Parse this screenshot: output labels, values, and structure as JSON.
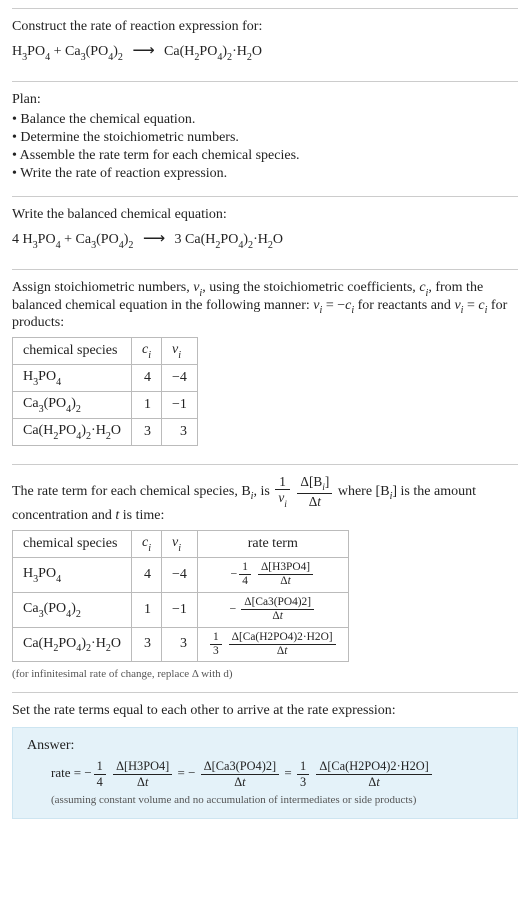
{
  "intro": {
    "prompt": "Construct the rate of reaction expression for:",
    "lhs1": "H",
    "lhs1s1": "3",
    "lhs1m": "PO",
    "lhs1s2": "4",
    "plus1": " + ",
    "lhs2": "Ca",
    "lhs2s1": "3",
    "lhs2m": "(PO",
    "lhs2s2": "4",
    "lhs2e": ")",
    "lhs2s3": "2",
    "arrow": "⟶",
    "rhs1": "Ca(H",
    "rhs1s1": "2",
    "rhs1m": "PO",
    "rhs1s2": "4",
    "rhs1e": ")",
    "rhs1s3": "2",
    "rhs1dot": "·H",
    "rhs1s4": "2",
    "rhs1o": "O"
  },
  "plan": {
    "label": "Plan:",
    "items": [
      "Balance the chemical equation.",
      "Determine the stoichiometric numbers.",
      "Assemble the rate term for each chemical species.",
      "Write the rate of reaction expression."
    ]
  },
  "balanced": {
    "label": "Write the balanced chemical equation:",
    "c1": "4 ",
    "c2": "",
    "c3": "3 "
  },
  "assign": {
    "text_a": "Assign stoichiometric numbers, ",
    "nu_i": "ν",
    "nu_i_sub": "i",
    "text_b": ", using the stoichiometric coefficients, ",
    "c_i": "c",
    "c_i_sub": "i",
    "text_c": ", from the balanced chemical equation in the following manner: ",
    "eq1a": "ν",
    "eq1as": "i",
    "eq1b": " = −",
    "eq1c": "c",
    "eq1cs": "i",
    "text_d": " for reactants and ",
    "eq2a": "ν",
    "eq2as": "i",
    "eq2b": " = ",
    "eq2c": "c",
    "eq2cs": "i",
    "text_e": " for products:"
  },
  "table1": {
    "h1": "chemical species",
    "h2": "c",
    "h2s": "i",
    "h3": "ν",
    "h3s": "i",
    "rows": [
      {
        "ci": "4",
        "vi": "−4"
      },
      {
        "ci": "1",
        "vi": "−1"
      },
      {
        "ci": "3",
        "vi": "3"
      }
    ]
  },
  "rateterm": {
    "text_a": "The rate term for each chemical species, B",
    "sub_i": "i",
    "text_b": ", is ",
    "frac1n": "1",
    "frac1d_a": "ν",
    "frac1d_s": "i",
    "frac2n": "Δ[B",
    "frac2n_s": "i",
    "frac2n_e": "]",
    "frac2d": "Δt",
    "text_c": " where [B",
    "text_c_s": "i",
    "text_c_e": "] is the amount concentration and ",
    "t_var": "t",
    "text_d": " is time:"
  },
  "table2": {
    "h1": "chemical species",
    "h2": "c",
    "h2s": "i",
    "h3": "ν",
    "h3s": "i",
    "h4": "rate term",
    "rows": [
      {
        "ci": "4",
        "vi": "−4",
        "sign": "−",
        "fn": "1",
        "fd": "4",
        "conc": "Δ[H3PO4]"
      },
      {
        "ci": "1",
        "vi": "−1",
        "sign": "−",
        "fn": "",
        "fd": "",
        "conc": "Δ[Ca3(PO4)2]"
      },
      {
        "ci": "3",
        "vi": "3",
        "sign": "",
        "fn": "1",
        "fd": "3",
        "conc": "Δ[Ca(H2PO4)2·H2O]"
      }
    ],
    "dt": "Δt",
    "note": "(for infinitesimal rate of change, replace Δ with d)"
  },
  "final": {
    "label": "Set the rate terms equal to each other to arrive at the rate expression:"
  },
  "answer": {
    "label": "Answer:",
    "rate": "rate = ",
    "neg": "−",
    "f1n": "1",
    "f1d": "4",
    "c1n": "Δ[H3PO4]",
    "dt": "Δt",
    "eq": " = ",
    "c2n": "Δ[Ca3(PO4)2]",
    "f3n": "1",
    "f3d": "3",
    "c3n": "Δ[Ca(H2PO4)2·H2O]",
    "note": "(assuming constant volume and no accumulation of intermediates or side products)"
  }
}
